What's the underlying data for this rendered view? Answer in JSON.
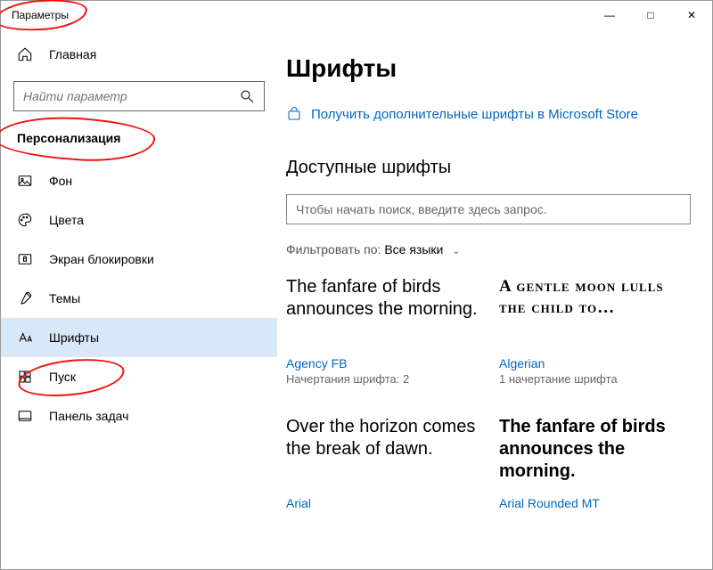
{
  "window": {
    "title": "Параметры"
  },
  "sidebar": {
    "home": "Главная",
    "search_placeholder": "Найти параметр",
    "section": "Персонализация",
    "items": [
      "Фон",
      "Цвета",
      "Экран блокировки",
      "Темы",
      "Шрифты",
      "Пуск",
      "Панель задач"
    ],
    "active_index": 4
  },
  "main": {
    "title": "Шрифты",
    "store_link": "Получить дополнительные шрифты в Microsoft Store",
    "available_heading": "Доступные шрифты",
    "font_search_placeholder": "Чтобы начать поиск, введите здесь запрос.",
    "filter_label": "Фильтровать по:",
    "filter_value": "Все языки",
    "fonts": [
      {
        "sample": "The fanfare of birds announces the morning.",
        "name": "Agency FB",
        "styles": "Начертания шрифта: 2"
      },
      {
        "sample": "A gentle moon lulls the child to…",
        "name": "Algerian",
        "styles": "1 начертание шрифта"
      },
      {
        "sample": "Over the horizon comes the break of dawn.",
        "name": "Arial",
        "styles": ""
      },
      {
        "sample": "The fanfare of birds announces the morning.",
        "name": "Arial Rounded MT",
        "styles": ""
      }
    ]
  }
}
